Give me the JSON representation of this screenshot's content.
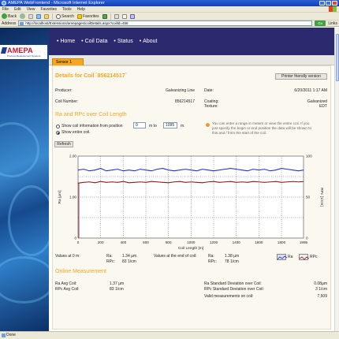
{
  "browser": {
    "title": "AMEPA WebFrontend - Microsoft Internet Explorer",
    "menu": [
      "File",
      "Edit",
      "View",
      "Favorites",
      "Tools",
      "Help"
    ],
    "toolbar": {
      "back": "Back",
      "search": "Search",
      "favorites": "Favorites"
    },
    "address_label": "Address",
    "address_value": "http://localhost/Extensions/amepages/coilDetails.aspx?coilId=456",
    "go_label": "Go",
    "links_label": "Links",
    "status": "Done"
  },
  "site": {
    "logo": "AMEPA",
    "logo_sub": "Process Measurement Systems",
    "nav": [
      "Home",
      "Coil Data",
      "Status",
      "About"
    ]
  },
  "tab": "Sensor 1",
  "details": {
    "title": "Details for Coil `856214517`",
    "print_button": "Printer friendly version",
    "producer_label": "Producer:",
    "producer_value": "Galvanizing Line",
    "date_label": "Date:",
    "date_value": "6/20/2011 1:17 AM",
    "coil_number_label": "Coil Number:",
    "coil_number_value": "856214517",
    "coating_label": "Coating:",
    "coating_value": "Galvanized",
    "texture_label": "Texture:",
    "texture_value": "EDT"
  },
  "range": {
    "heading": "Ra and RPc over Coil Length",
    "opt1_label": "Show coil information from position",
    "from_value": "0",
    "to_label": "m to",
    "to_value": "1095",
    "unit": "m.",
    "opt2_label": "Show entire coil.",
    "hint": "You can enter a range in meters or view the entire coil. If you just specify the begin or end position the data will be shown to this and / from the start of the coil.",
    "refresh": "Refresh"
  },
  "chart_data": {
    "type": "line",
    "xlabel": "Coil Length [m]",
    "ylabel_left": "Ra [µm]",
    "ylabel_right": "RPc [1/cm]",
    "xlim": [
      0,
      1995
    ],
    "x_ticks": [
      "0",
      "200",
      "400",
      "600",
      "800",
      "1000",
      "1200",
      "1400",
      "1600",
      "1800",
      "1995"
    ],
    "ylim_left": [
      0,
      2
    ],
    "y_ticks_left": [
      "0",
      "1.00",
      "2.00"
    ],
    "ylim_right": [
      0,
      100
    ],
    "y_ticks_right": [
      "0",
      "50",
      "100"
    ],
    "series": [
      {
        "name": "Ra",
        "color": "#8b1a1a",
        "axis": "left",
        "x": [
          0,
          50,
          100,
          150,
          200,
          250,
          300,
          350,
          400,
          450,
          500,
          550,
          600,
          650,
          700,
          750,
          800,
          850,
          900,
          950,
          1000,
          1050,
          1100,
          1150,
          1200,
          1250,
          1300,
          1350,
          1400,
          1450,
          1500,
          1550,
          1600,
          1650,
          1700,
          1750,
          1800,
          1850,
          1900,
          1950,
          1995
        ],
        "values": [
          1.34,
          1.36,
          1.37,
          1.35,
          1.38,
          1.36,
          1.37,
          1.36,
          1.38,
          1.35,
          1.36,
          1.37,
          1.36,
          1.38,
          1.37,
          1.36,
          1.35,
          1.37,
          1.38,
          1.36,
          1.37,
          1.36,
          1.35,
          1.37,
          1.38,
          1.36,
          1.37,
          1.38,
          1.36,
          1.37,
          1.36,
          1.38,
          1.37,
          1.36,
          1.37,
          1.38,
          1.36,
          1.37,
          1.38,
          1.37,
          1.38
        ]
      },
      {
        "name": "RPc",
        "color": "#2233cc",
        "axis": "right",
        "x": [
          0,
          50,
          100,
          150,
          200,
          250,
          300,
          350,
          400,
          450,
          500,
          550,
          600,
          650,
          700,
          750,
          800,
          850,
          900,
          950,
          1000,
          1050,
          1100,
          1150,
          1200,
          1250,
          1300,
          1350,
          1400,
          1450,
          1500,
          1550,
          1600,
          1650,
          1700,
          1750,
          1800,
          1850,
          1900,
          1950,
          1995
        ],
        "values": [
          83,
          84,
          82,
          83,
          85,
          82,
          83,
          84,
          82,
          83,
          82,
          84,
          83,
          82,
          84,
          85,
          83,
          82,
          83,
          84,
          83,
          82,
          84,
          83,
          82,
          83,
          84,
          85,
          84,
          83,
          82,
          84,
          83,
          84,
          82,
          83,
          85,
          84,
          83,
          82,
          83
        ]
      }
    ],
    "grid": true,
    "legend": "bottom-right"
  },
  "values_at": {
    "start_label": "Values at 0 m:",
    "ra_label": "Ra:",
    "ra_start": "1.34 µm",
    "rpc_label": "RPc:",
    "rpc_start": "83 1/cm",
    "end_label": "Values at the end of coil:",
    "ra_end": "1.38 µm",
    "rpc_end": "78 1/cm",
    "legend_ra": "Ra",
    "legend_rpc": "RPc"
  },
  "online": {
    "heading": "Online Measurement",
    "ra_avg_label": "Ra Avg Coil:",
    "ra_avg": "1.37 µm",
    "rpc_avg_label": "RPc Avg Coil:",
    "rpc_avg": "83 1/cm",
    "ra_std_label": "Ra Standard Deviation over Coil:",
    "ra_std": "0.08µm",
    "rpc_std_label": "RPc Standard Deviation over Coil:",
    "rpc_std": "3 1/cm",
    "valid_label": "Valid measurements on coil:",
    "valid": "7,509"
  }
}
